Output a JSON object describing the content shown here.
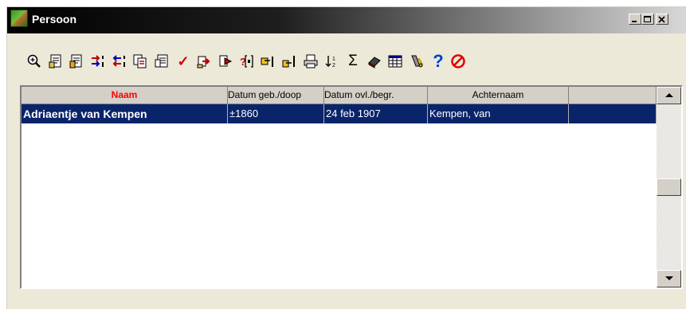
{
  "window": {
    "title": "Persoon",
    "caption_buttons": [
      "minimize",
      "maximize",
      "close"
    ]
  },
  "toolbar": {
    "tools": [
      {
        "icon": "zoom-icon"
      },
      {
        "icon": "edit-document-icon"
      },
      {
        "icon": "edit-document-2-icon"
      },
      {
        "icon": "arrow-insert-red-icon"
      },
      {
        "icon": "arrow-insert-blue-icon"
      },
      {
        "icon": "copy-document-icon"
      },
      {
        "icon": "document-list-icon"
      },
      {
        "icon": "checkmark-icon"
      },
      {
        "icon": "export-icon"
      },
      {
        "icon": "forward-icon"
      },
      {
        "icon": "search-brackets-icon"
      },
      {
        "icon": "pointer-icon"
      },
      {
        "icon": "pointer-2-icon"
      },
      {
        "icon": "print-icon"
      },
      {
        "icon": "sort-icon"
      },
      {
        "icon": "sum-icon"
      },
      {
        "icon": "eraser-icon"
      },
      {
        "icon": "table-icon"
      },
      {
        "icon": "key-tools-icon"
      },
      {
        "icon": "help-icon"
      },
      {
        "icon": "cancel-icon"
      }
    ],
    "sum_glyph": "Σ",
    "help_glyph": "?",
    "check_glyph": "✓"
  },
  "grid": {
    "columns": [
      "Naam",
      "Datum geb./doop",
      "Datum ovl./begr.",
      "Achternaam",
      ""
    ],
    "selected_column": 0,
    "rows": [
      {
        "naam": "Adriaentje van Kempen",
        "geb": "±1860",
        "ovl": "24 feb 1907",
        "achternaam": "Kempen, van",
        "extra": ""
      }
    ],
    "selected_row": 0
  },
  "colors": {
    "selection": "#0a246a",
    "header_highlight": "#ff0000",
    "face": "#d4d0c8"
  }
}
